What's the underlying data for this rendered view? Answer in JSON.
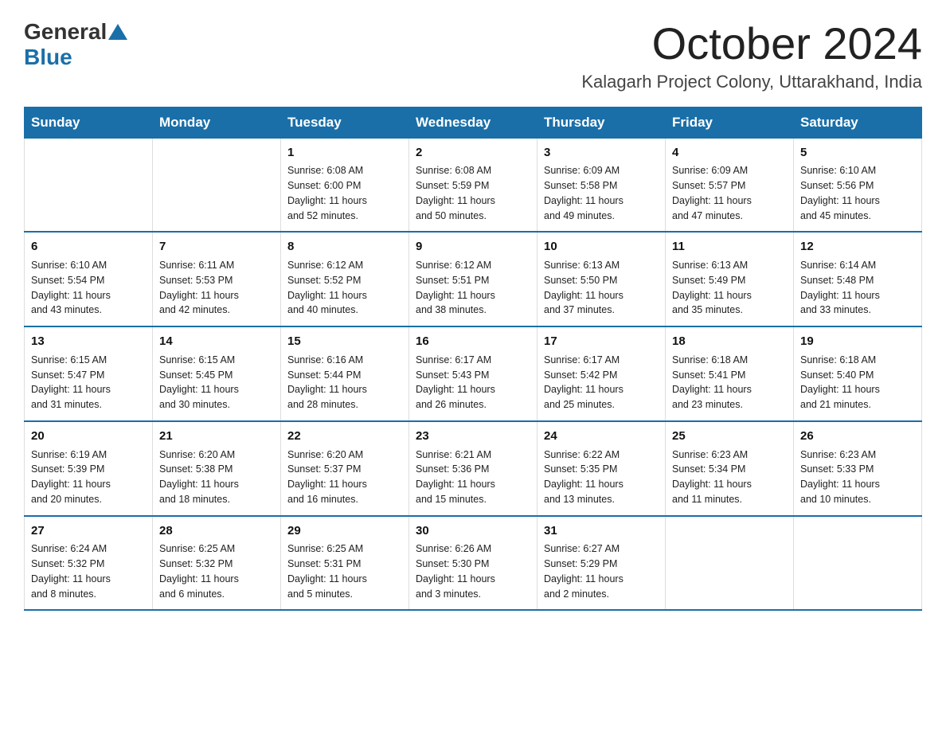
{
  "logo": {
    "general": "General",
    "blue": "Blue"
  },
  "header": {
    "month": "October 2024",
    "location": "Kalagarh Project Colony, Uttarakhand, India"
  },
  "weekdays": [
    "Sunday",
    "Monday",
    "Tuesday",
    "Wednesday",
    "Thursday",
    "Friday",
    "Saturday"
  ],
  "weeks": [
    [
      {
        "day": "",
        "detail": ""
      },
      {
        "day": "",
        "detail": ""
      },
      {
        "day": "1",
        "detail": "Sunrise: 6:08 AM\nSunset: 6:00 PM\nDaylight: 11 hours\nand 52 minutes."
      },
      {
        "day": "2",
        "detail": "Sunrise: 6:08 AM\nSunset: 5:59 PM\nDaylight: 11 hours\nand 50 minutes."
      },
      {
        "day": "3",
        "detail": "Sunrise: 6:09 AM\nSunset: 5:58 PM\nDaylight: 11 hours\nand 49 minutes."
      },
      {
        "day": "4",
        "detail": "Sunrise: 6:09 AM\nSunset: 5:57 PM\nDaylight: 11 hours\nand 47 minutes."
      },
      {
        "day": "5",
        "detail": "Sunrise: 6:10 AM\nSunset: 5:56 PM\nDaylight: 11 hours\nand 45 minutes."
      }
    ],
    [
      {
        "day": "6",
        "detail": "Sunrise: 6:10 AM\nSunset: 5:54 PM\nDaylight: 11 hours\nand 43 minutes."
      },
      {
        "day": "7",
        "detail": "Sunrise: 6:11 AM\nSunset: 5:53 PM\nDaylight: 11 hours\nand 42 minutes."
      },
      {
        "day": "8",
        "detail": "Sunrise: 6:12 AM\nSunset: 5:52 PM\nDaylight: 11 hours\nand 40 minutes."
      },
      {
        "day": "9",
        "detail": "Sunrise: 6:12 AM\nSunset: 5:51 PM\nDaylight: 11 hours\nand 38 minutes."
      },
      {
        "day": "10",
        "detail": "Sunrise: 6:13 AM\nSunset: 5:50 PM\nDaylight: 11 hours\nand 37 minutes."
      },
      {
        "day": "11",
        "detail": "Sunrise: 6:13 AM\nSunset: 5:49 PM\nDaylight: 11 hours\nand 35 minutes."
      },
      {
        "day": "12",
        "detail": "Sunrise: 6:14 AM\nSunset: 5:48 PM\nDaylight: 11 hours\nand 33 minutes."
      }
    ],
    [
      {
        "day": "13",
        "detail": "Sunrise: 6:15 AM\nSunset: 5:47 PM\nDaylight: 11 hours\nand 31 minutes."
      },
      {
        "day": "14",
        "detail": "Sunrise: 6:15 AM\nSunset: 5:45 PM\nDaylight: 11 hours\nand 30 minutes."
      },
      {
        "day": "15",
        "detail": "Sunrise: 6:16 AM\nSunset: 5:44 PM\nDaylight: 11 hours\nand 28 minutes."
      },
      {
        "day": "16",
        "detail": "Sunrise: 6:17 AM\nSunset: 5:43 PM\nDaylight: 11 hours\nand 26 minutes."
      },
      {
        "day": "17",
        "detail": "Sunrise: 6:17 AM\nSunset: 5:42 PM\nDaylight: 11 hours\nand 25 minutes."
      },
      {
        "day": "18",
        "detail": "Sunrise: 6:18 AM\nSunset: 5:41 PM\nDaylight: 11 hours\nand 23 minutes."
      },
      {
        "day": "19",
        "detail": "Sunrise: 6:18 AM\nSunset: 5:40 PM\nDaylight: 11 hours\nand 21 minutes."
      }
    ],
    [
      {
        "day": "20",
        "detail": "Sunrise: 6:19 AM\nSunset: 5:39 PM\nDaylight: 11 hours\nand 20 minutes."
      },
      {
        "day": "21",
        "detail": "Sunrise: 6:20 AM\nSunset: 5:38 PM\nDaylight: 11 hours\nand 18 minutes."
      },
      {
        "day": "22",
        "detail": "Sunrise: 6:20 AM\nSunset: 5:37 PM\nDaylight: 11 hours\nand 16 minutes."
      },
      {
        "day": "23",
        "detail": "Sunrise: 6:21 AM\nSunset: 5:36 PM\nDaylight: 11 hours\nand 15 minutes."
      },
      {
        "day": "24",
        "detail": "Sunrise: 6:22 AM\nSunset: 5:35 PM\nDaylight: 11 hours\nand 13 minutes."
      },
      {
        "day": "25",
        "detail": "Sunrise: 6:23 AM\nSunset: 5:34 PM\nDaylight: 11 hours\nand 11 minutes."
      },
      {
        "day": "26",
        "detail": "Sunrise: 6:23 AM\nSunset: 5:33 PM\nDaylight: 11 hours\nand 10 minutes."
      }
    ],
    [
      {
        "day": "27",
        "detail": "Sunrise: 6:24 AM\nSunset: 5:32 PM\nDaylight: 11 hours\nand 8 minutes."
      },
      {
        "day": "28",
        "detail": "Sunrise: 6:25 AM\nSunset: 5:32 PM\nDaylight: 11 hours\nand 6 minutes."
      },
      {
        "day": "29",
        "detail": "Sunrise: 6:25 AM\nSunset: 5:31 PM\nDaylight: 11 hours\nand 5 minutes."
      },
      {
        "day": "30",
        "detail": "Sunrise: 6:26 AM\nSunset: 5:30 PM\nDaylight: 11 hours\nand 3 minutes."
      },
      {
        "day": "31",
        "detail": "Sunrise: 6:27 AM\nSunset: 5:29 PM\nDaylight: 11 hours\nand 2 minutes."
      },
      {
        "day": "",
        "detail": ""
      },
      {
        "day": "",
        "detail": ""
      }
    ]
  ]
}
